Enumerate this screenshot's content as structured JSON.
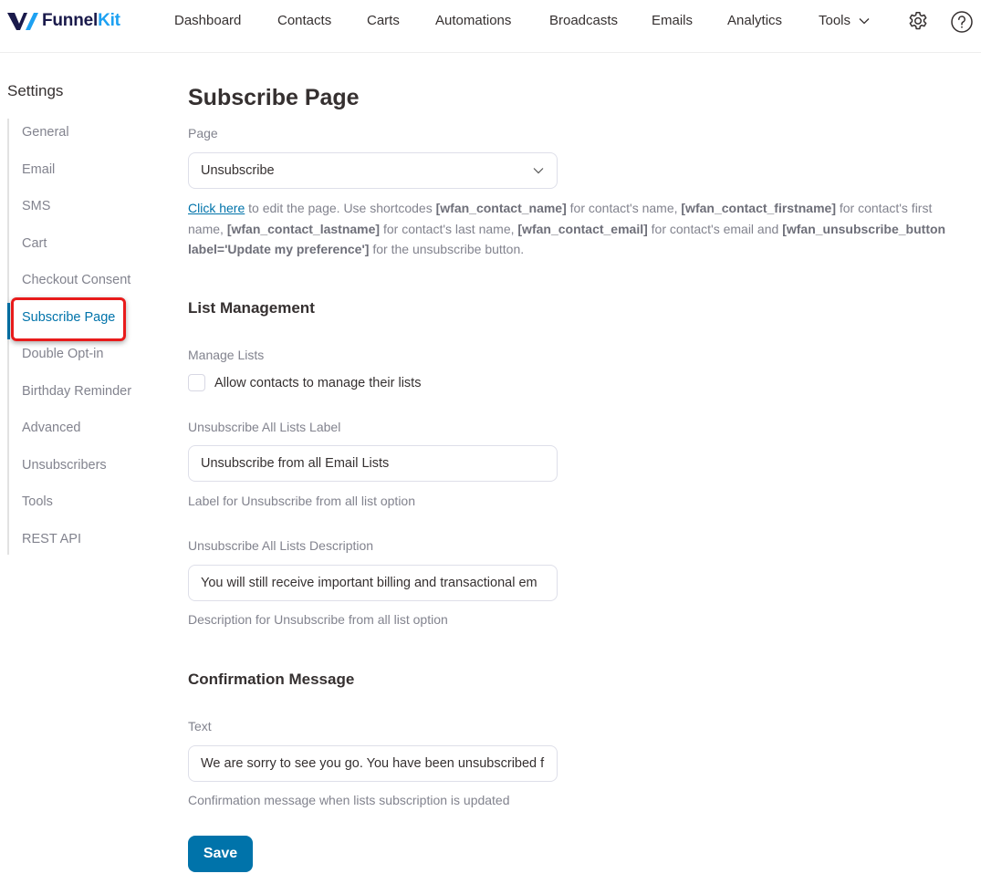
{
  "brand": {
    "name_part1": "Funnel",
    "name_part2": "Kit"
  },
  "nav": {
    "items": [
      "Dashboard",
      "Contacts",
      "Carts",
      "Automations",
      "Broadcasts",
      "Emails",
      "Analytics"
    ],
    "tools_label": "Tools",
    "settings_icon": "gear-icon",
    "help_icon": "question-icon"
  },
  "sidebar": {
    "title": "Settings",
    "items": [
      {
        "label": "General"
      },
      {
        "label": "Email"
      },
      {
        "label": "SMS"
      },
      {
        "label": "Cart"
      },
      {
        "label": "Checkout Consent"
      },
      {
        "label": "Subscribe Page",
        "active": true
      },
      {
        "label": "Double Opt-in"
      },
      {
        "label": "Birthday Reminder"
      },
      {
        "label": "Advanced"
      },
      {
        "label": "Unsubscribers"
      },
      {
        "label": "Tools"
      },
      {
        "label": "REST API"
      }
    ]
  },
  "main": {
    "title": "Subscribe Page",
    "page_field": {
      "label": "Page",
      "value": "Unsubscribe",
      "help": {
        "link": "Click here",
        "t1": " to edit the page. Use shortcodes ",
        "c1": "[wfan_contact_name]",
        "t2": " for contact's name, ",
        "c2": "[wfan_contact_firstname]",
        "t3": " for contact's first name, ",
        "c3": "[wfan_contact_lastname]",
        "t4": " for contact's last name, ",
        "c4": "[wfan_contact_email]",
        "t5": " for contact's email and ",
        "c5": "[wfan_unsubscribe_button label='Update my preference']",
        "t6": " for the unsubscribe button."
      }
    },
    "list_management": {
      "title": "List Management",
      "manage_lists_label": "Manage Lists",
      "checkbox_label": "Allow contacts to manage their lists",
      "checkbox_checked": false,
      "unsub_all_label": {
        "label": "Unsubscribe All Lists Label",
        "value": "Unsubscribe from all Email Lists",
        "description": "Label for Unsubscribe from all list option"
      },
      "unsub_all_desc": {
        "label": "Unsubscribe All Lists Description",
        "value": "You will still receive important billing and transactional em",
        "description": "Description for Unsubscribe from all list option"
      }
    },
    "confirmation": {
      "title": "Confirmation Message",
      "label": "Text",
      "value": "We are sorry to see you go. You have been unsubscribed fr",
      "description": "Confirmation message when lists subscription is updated"
    },
    "save_label": "Save"
  },
  "colors": {
    "accent": "#0073aa",
    "highlight": "#e81b1b",
    "brand_dark": "#1a1a4b",
    "brand_light": "#1da1f2"
  }
}
